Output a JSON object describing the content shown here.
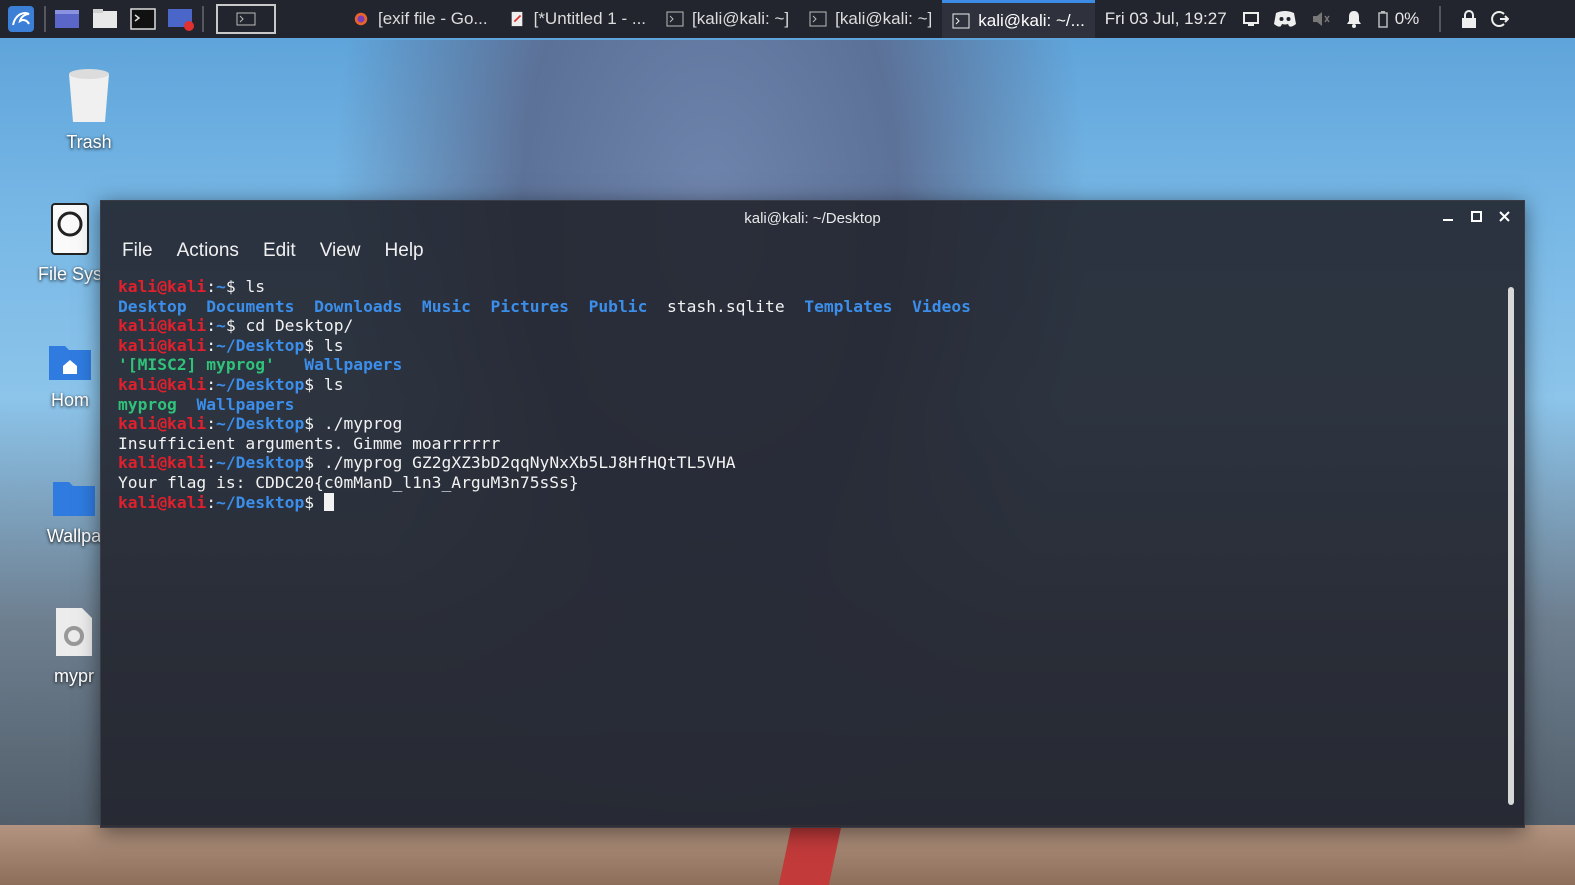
{
  "panel": {
    "tasks": [
      {
        "label": "[exif file - Go...",
        "icon": "firefox-icon"
      },
      {
        "label": "[*Untitled 1 - ...",
        "icon": "editor-icon"
      },
      {
        "label": "[kali@kali: ~]",
        "icon": "terminal-icon"
      },
      {
        "label": "[kali@kali: ~]",
        "icon": "terminal-icon"
      },
      {
        "label": "kali@kali: ~/...",
        "icon": "terminal-icon"
      }
    ],
    "clock": "Fri 03 Jul, 19:27",
    "battery": "0%"
  },
  "desktop": {
    "icons": [
      {
        "label": "Trash",
        "icon": "trash-icon"
      },
      {
        "label": "File Sys",
        "icon": "drive-icon"
      },
      {
        "label": "Hom",
        "icon": "home-folder-icon"
      },
      {
        "label": "Wallpa",
        "icon": "folder-icon"
      },
      {
        "label": "mypr",
        "icon": "executable-icon"
      }
    ]
  },
  "terminal": {
    "title": "kali@kali: ~/Desktop",
    "menu": [
      "File",
      "Actions",
      "Edit",
      "View",
      "Help"
    ],
    "prompt_user": "kali@kali",
    "lines": [
      {
        "path": "~",
        "cmd": " ls"
      },
      {
        "path": "~/Desktop",
        "cmd": " ls"
      },
      {
        "path": "~/Desktop",
        "cmd": " ls"
      },
      {
        "path": "~/Desktop",
        "cmd": " ./myprog"
      },
      {
        "path": "~/Desktop",
        "cmd": " ./myprog GZ2gXZ3bD2qqNyNxXb5LJ8HfHQtTL5VHA"
      },
      {
        "path": "~/Desktop",
        "cmd": " "
      }
    ],
    "ls_home": [
      "Desktop",
      "Documents",
      "Downloads",
      "Music",
      "Pictures",
      "Public",
      "stash.sqlite",
      "Templates",
      "Videos"
    ],
    "cd_line": {
      "path": "~",
      "cmd": " cd Desktop/"
    },
    "ls_desktop_1": [
      "'[MISC2] myprog'",
      "Wallpapers"
    ],
    "ls_desktop_2": [
      "myprog",
      "Wallpapers"
    ],
    "output_insufficient": "Insufficient arguments. Gimme moarrrrrr",
    "output_flag": "Your flag is: CDDC20{c0mManD_l1n3_ArguM3n75sSs}"
  }
}
